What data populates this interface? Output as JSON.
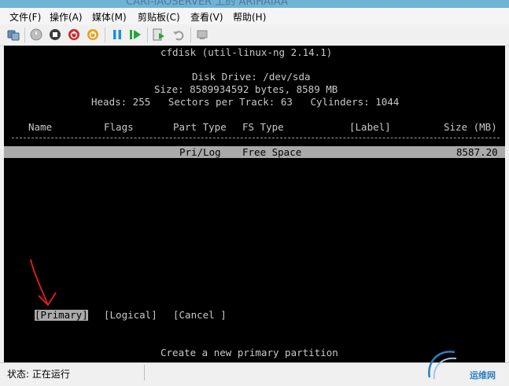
{
  "window": {
    "title": "CARI-IAOSERVER 上的 ARIHAIAA"
  },
  "menu": [
    "文件(F)",
    "操作(A)",
    "媒体(M)",
    "剪贴板(C)",
    "查看(V)",
    "帮助(H)"
  ],
  "toolbar": {
    "icons": [
      "ctrl-alt-del-icon",
      "start-icon",
      "turn-off-icon",
      "shutdown-icon",
      "save-icon",
      "pause-icon",
      "reset-icon",
      "checkpoint-icon",
      "revert-icon",
      "enhanced-session-icon"
    ]
  },
  "console": {
    "program": "cfdisk (util-linux-ng 2.14.1)",
    "disk_drive": "Disk Drive: /dev/sda",
    "size_line": "Size: 8589934592 bytes, 8589 MB",
    "geometry_line": "Heads: 255   Sectors per Track: 63   Cylinders: 1044",
    "headers": {
      "name": "Name",
      "flags": "Flags",
      "part_type": "Part Type",
      "fs_type": "FS Type",
      "label": "[Label]",
      "size": "Size (MB)"
    },
    "row": {
      "part_type": "Pri/Log",
      "fs_type": "Free Space",
      "size": "8587.20"
    },
    "buttons": {
      "primary": "[Primary]",
      "logical": "[Logical]",
      "cancel": "[Cancel ]"
    },
    "hint": "Create a new primary partition"
  },
  "status": {
    "text": "状态: 正在运行"
  },
  "watermark": {
    "text": "运维网"
  }
}
